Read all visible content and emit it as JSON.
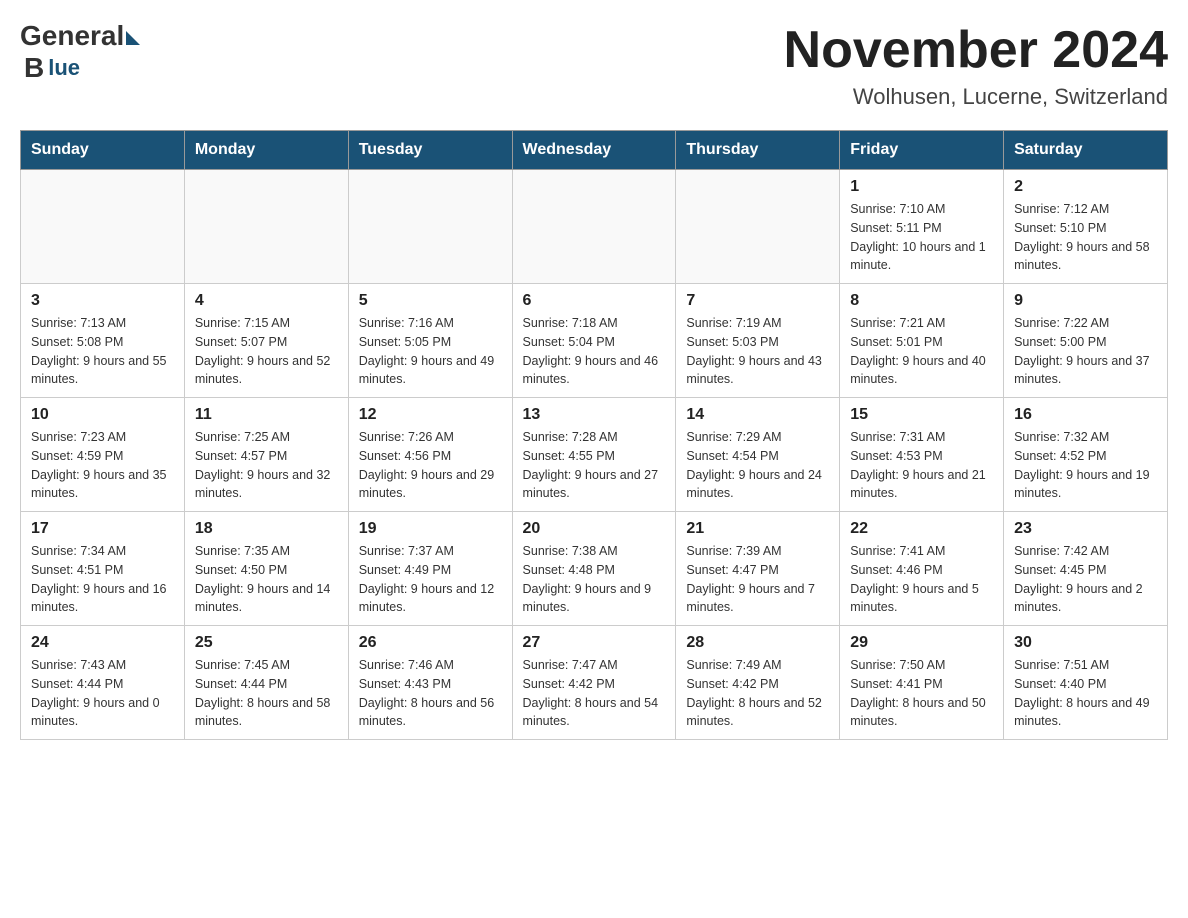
{
  "logo": {
    "general": "General",
    "blue": "Blue"
  },
  "header": {
    "month": "November 2024",
    "location": "Wolhusen, Lucerne, Switzerland"
  },
  "weekdays": [
    "Sunday",
    "Monday",
    "Tuesday",
    "Wednesday",
    "Thursday",
    "Friday",
    "Saturday"
  ],
  "weeks": [
    [
      {
        "day": "",
        "info": ""
      },
      {
        "day": "",
        "info": ""
      },
      {
        "day": "",
        "info": ""
      },
      {
        "day": "",
        "info": ""
      },
      {
        "day": "",
        "info": ""
      },
      {
        "day": "1",
        "info": "Sunrise: 7:10 AM\nSunset: 5:11 PM\nDaylight: 10 hours and 1 minute."
      },
      {
        "day": "2",
        "info": "Sunrise: 7:12 AM\nSunset: 5:10 PM\nDaylight: 9 hours and 58 minutes."
      }
    ],
    [
      {
        "day": "3",
        "info": "Sunrise: 7:13 AM\nSunset: 5:08 PM\nDaylight: 9 hours and 55 minutes."
      },
      {
        "day": "4",
        "info": "Sunrise: 7:15 AM\nSunset: 5:07 PM\nDaylight: 9 hours and 52 minutes."
      },
      {
        "day": "5",
        "info": "Sunrise: 7:16 AM\nSunset: 5:05 PM\nDaylight: 9 hours and 49 minutes."
      },
      {
        "day": "6",
        "info": "Sunrise: 7:18 AM\nSunset: 5:04 PM\nDaylight: 9 hours and 46 minutes."
      },
      {
        "day": "7",
        "info": "Sunrise: 7:19 AM\nSunset: 5:03 PM\nDaylight: 9 hours and 43 minutes."
      },
      {
        "day": "8",
        "info": "Sunrise: 7:21 AM\nSunset: 5:01 PM\nDaylight: 9 hours and 40 minutes."
      },
      {
        "day": "9",
        "info": "Sunrise: 7:22 AM\nSunset: 5:00 PM\nDaylight: 9 hours and 37 minutes."
      }
    ],
    [
      {
        "day": "10",
        "info": "Sunrise: 7:23 AM\nSunset: 4:59 PM\nDaylight: 9 hours and 35 minutes."
      },
      {
        "day": "11",
        "info": "Sunrise: 7:25 AM\nSunset: 4:57 PM\nDaylight: 9 hours and 32 minutes."
      },
      {
        "day": "12",
        "info": "Sunrise: 7:26 AM\nSunset: 4:56 PM\nDaylight: 9 hours and 29 minutes."
      },
      {
        "day": "13",
        "info": "Sunrise: 7:28 AM\nSunset: 4:55 PM\nDaylight: 9 hours and 27 minutes."
      },
      {
        "day": "14",
        "info": "Sunrise: 7:29 AM\nSunset: 4:54 PM\nDaylight: 9 hours and 24 minutes."
      },
      {
        "day": "15",
        "info": "Sunrise: 7:31 AM\nSunset: 4:53 PM\nDaylight: 9 hours and 21 minutes."
      },
      {
        "day": "16",
        "info": "Sunrise: 7:32 AM\nSunset: 4:52 PM\nDaylight: 9 hours and 19 minutes."
      }
    ],
    [
      {
        "day": "17",
        "info": "Sunrise: 7:34 AM\nSunset: 4:51 PM\nDaylight: 9 hours and 16 minutes."
      },
      {
        "day": "18",
        "info": "Sunrise: 7:35 AM\nSunset: 4:50 PM\nDaylight: 9 hours and 14 minutes."
      },
      {
        "day": "19",
        "info": "Sunrise: 7:37 AM\nSunset: 4:49 PM\nDaylight: 9 hours and 12 minutes."
      },
      {
        "day": "20",
        "info": "Sunrise: 7:38 AM\nSunset: 4:48 PM\nDaylight: 9 hours and 9 minutes."
      },
      {
        "day": "21",
        "info": "Sunrise: 7:39 AM\nSunset: 4:47 PM\nDaylight: 9 hours and 7 minutes."
      },
      {
        "day": "22",
        "info": "Sunrise: 7:41 AM\nSunset: 4:46 PM\nDaylight: 9 hours and 5 minutes."
      },
      {
        "day": "23",
        "info": "Sunrise: 7:42 AM\nSunset: 4:45 PM\nDaylight: 9 hours and 2 minutes."
      }
    ],
    [
      {
        "day": "24",
        "info": "Sunrise: 7:43 AM\nSunset: 4:44 PM\nDaylight: 9 hours and 0 minutes."
      },
      {
        "day": "25",
        "info": "Sunrise: 7:45 AM\nSunset: 4:44 PM\nDaylight: 8 hours and 58 minutes."
      },
      {
        "day": "26",
        "info": "Sunrise: 7:46 AM\nSunset: 4:43 PM\nDaylight: 8 hours and 56 minutes."
      },
      {
        "day": "27",
        "info": "Sunrise: 7:47 AM\nSunset: 4:42 PM\nDaylight: 8 hours and 54 minutes."
      },
      {
        "day": "28",
        "info": "Sunrise: 7:49 AM\nSunset: 4:42 PM\nDaylight: 8 hours and 52 minutes."
      },
      {
        "day": "29",
        "info": "Sunrise: 7:50 AM\nSunset: 4:41 PM\nDaylight: 8 hours and 50 minutes."
      },
      {
        "day": "30",
        "info": "Sunrise: 7:51 AM\nSunset: 4:40 PM\nDaylight: 8 hours and 49 minutes."
      }
    ]
  ]
}
